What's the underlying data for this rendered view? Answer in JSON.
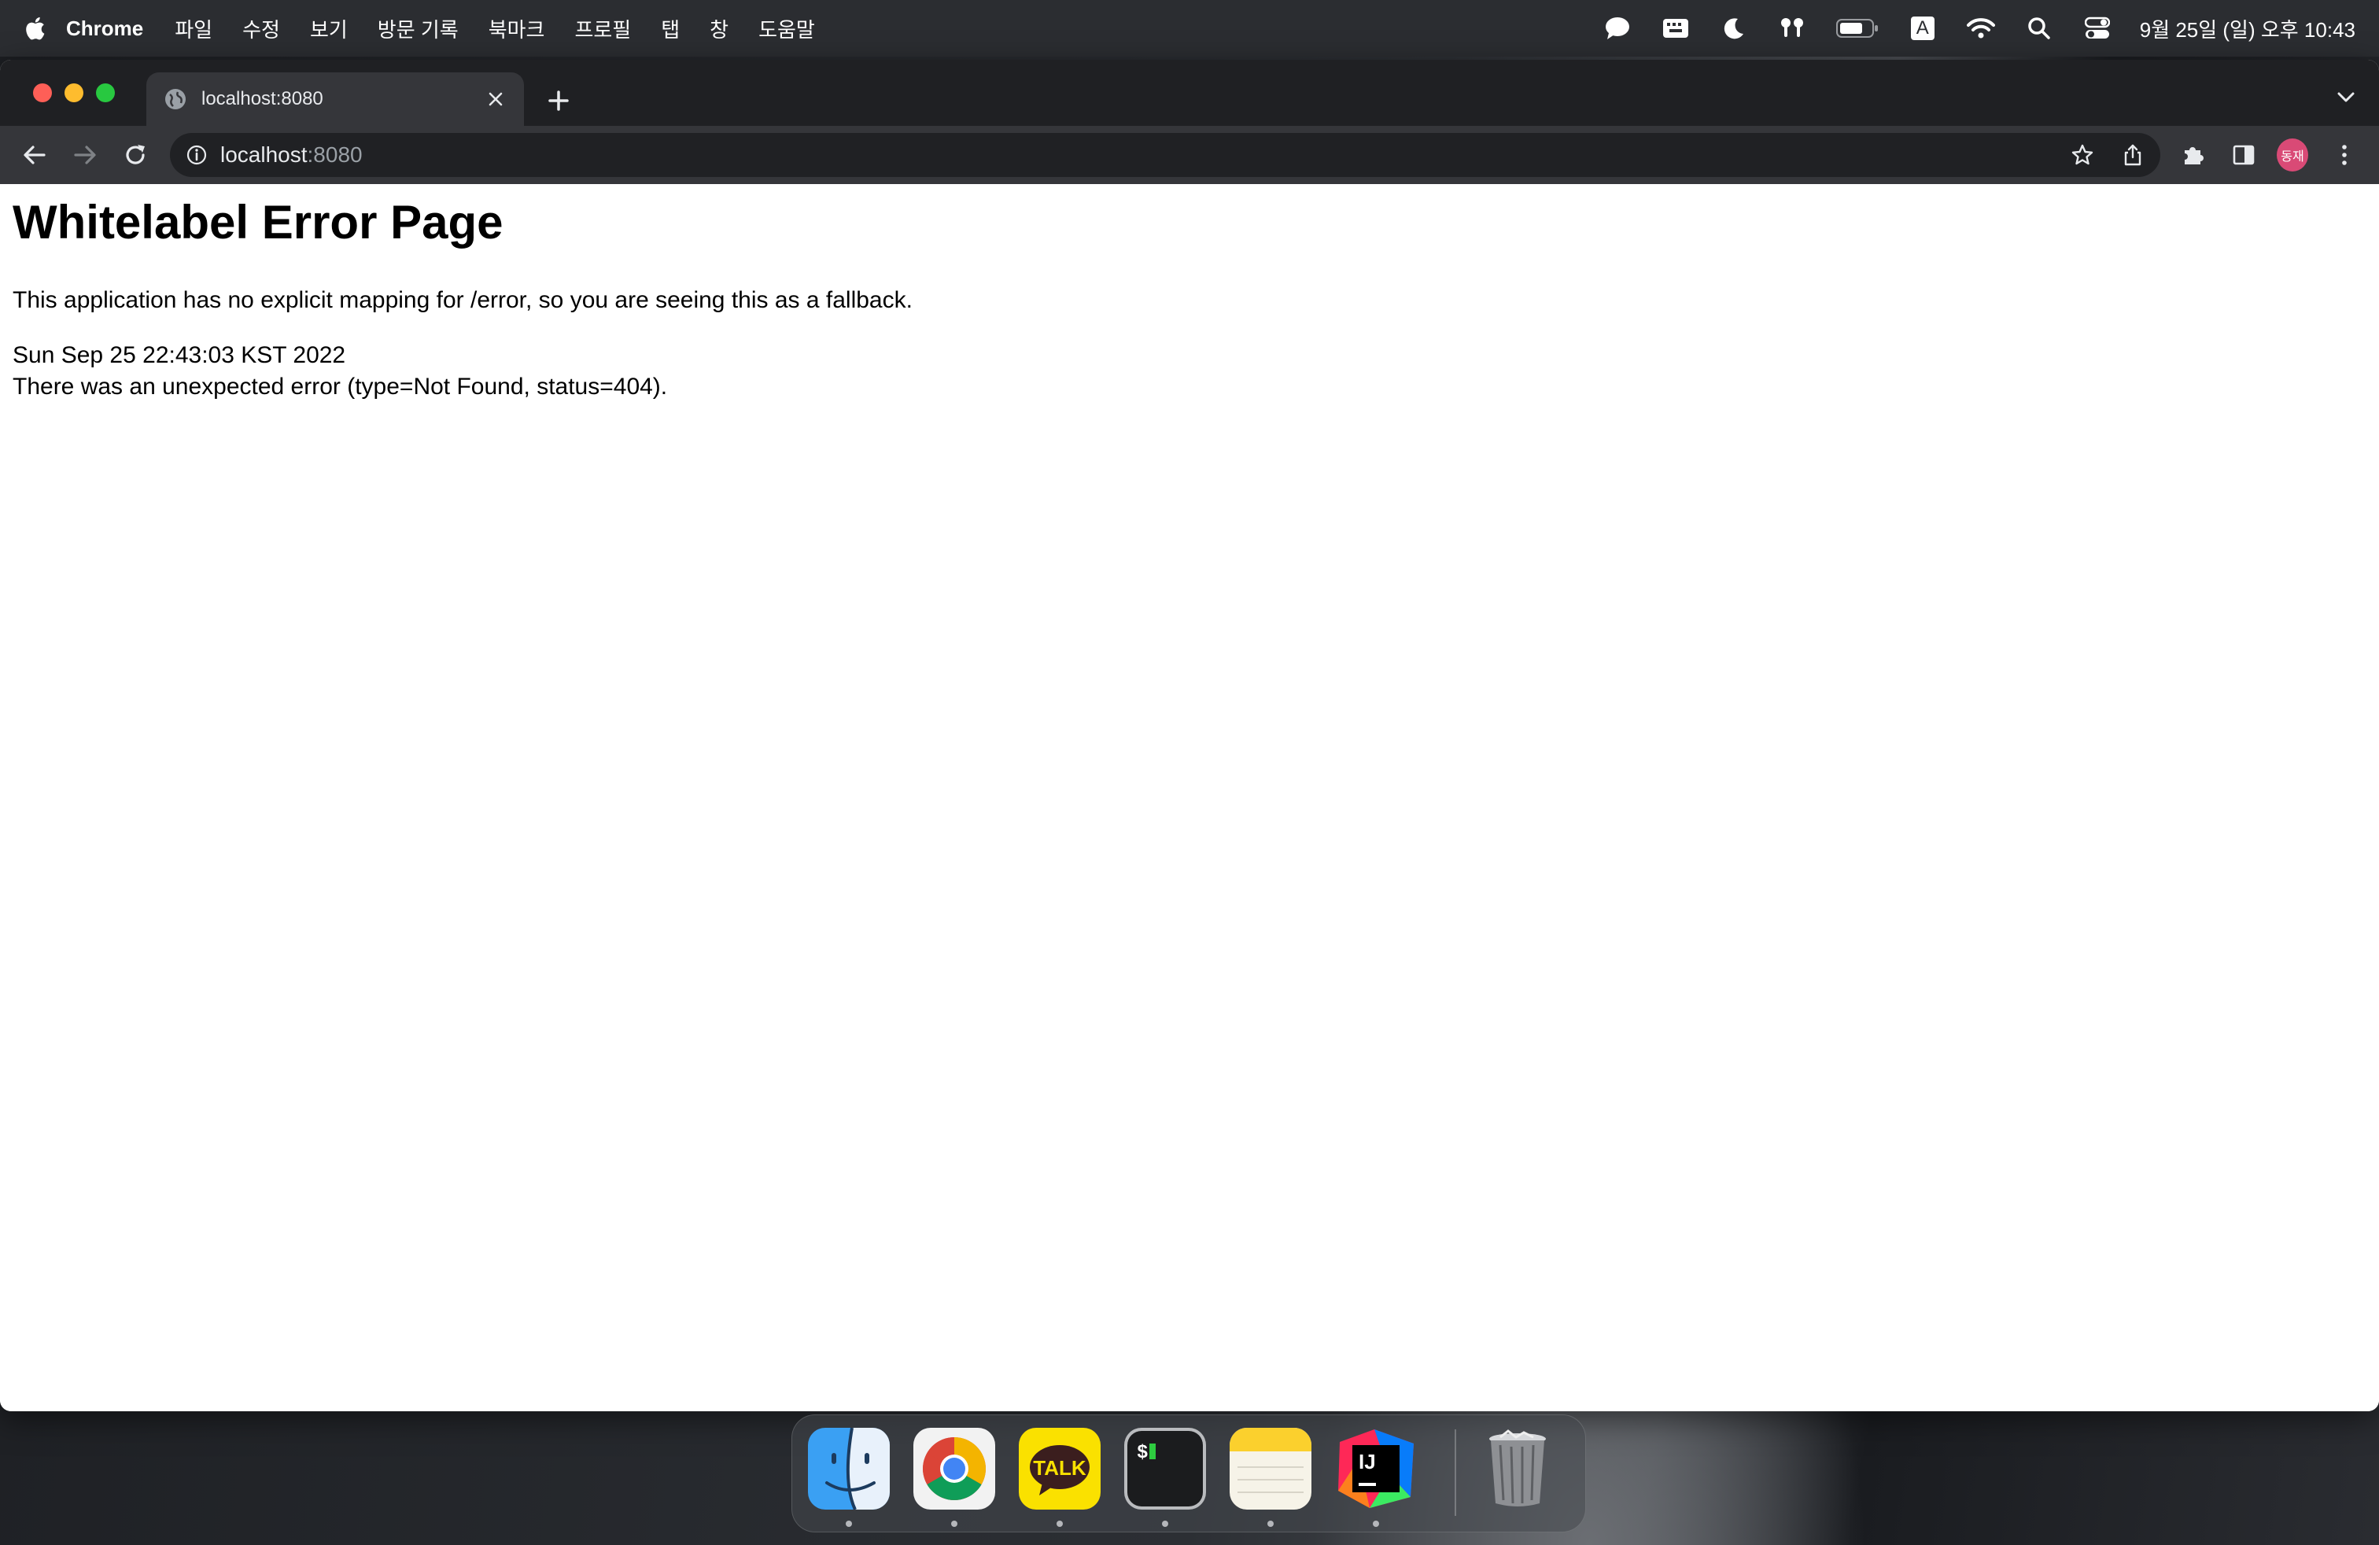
{
  "menubar": {
    "app_name": "Chrome",
    "items": [
      "파일",
      "수정",
      "보기",
      "방문 기록",
      "북마크",
      "프로필",
      "탭",
      "창",
      "도움말"
    ],
    "clock": "9월 25일 (일) 오후 10:43",
    "input_source": "A"
  },
  "tab": {
    "title": "localhost:8080"
  },
  "omnibox": {
    "host": "localhost",
    "port": ":8080"
  },
  "profile": {
    "initials": "동재",
    "color": "#d94a76"
  },
  "page": {
    "title": "Whitelabel Error Page",
    "message": "This application has no explicit mapping for /error, so you are seeing this as a fallback.",
    "timestamp": "Sun Sep 25 22:43:03 KST 2022",
    "error": "There was an unexpected error (type=Not Found, status=404)."
  },
  "dock": {
    "apps": [
      {
        "name": "Finder",
        "icon": "finder-icon"
      },
      {
        "name": "Chrome",
        "icon": "chrome-icon"
      },
      {
        "name": "KakaoTalk",
        "icon": "kakaotalk-icon",
        "label": "TALK"
      },
      {
        "name": "Terminal",
        "icon": "terminal-icon",
        "label": "$"
      },
      {
        "name": "Notes",
        "icon": "notes-icon"
      },
      {
        "name": "IntelliJ IDEA",
        "icon": "intellij-icon",
        "label": "IJ"
      },
      {
        "name": "Trash",
        "icon": "trash-icon"
      }
    ]
  }
}
